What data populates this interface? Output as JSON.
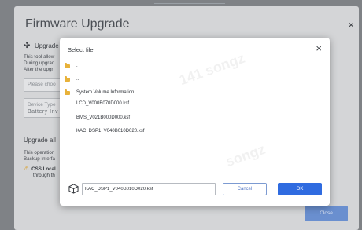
{
  "background": {
    "title": "Firmware Upgrade",
    "close_glyph": "×",
    "section_upgrade": "Upgrade",
    "desc_lines": [
      "This tool allow",
      "During upgrad",
      "After the upgr"
    ],
    "choose_placeholder": "Please choo",
    "device_type_label": "Device Type",
    "device_type_value": "Battery Inv",
    "section_upgrade_all": "Upgrade all",
    "op_lines": [
      "This operation",
      "Backup Interfa"
    ],
    "warning_bold": "CSS Local",
    "warning_rest": "through th",
    "close_button": "Close"
  },
  "dialog": {
    "title": "Select file",
    "close_glyph": "×",
    "entries": [
      {
        "type": "folder",
        "name": "."
      },
      {
        "type": "folder",
        "name": ".."
      },
      {
        "type": "folder",
        "name": "System Volume Information"
      },
      {
        "type": "file",
        "name": "LCD_V000B070D000.ksf"
      },
      {
        "type": "file",
        "name": "BMS_V021B000D000.ksf"
      },
      {
        "type": "file",
        "name": "KAC_DSP1_V040B010D020.ksf"
      }
    ],
    "selected_file": "KAC_DSP1_V040B010D020.ksf",
    "cancel_label": "Cancel",
    "ok_label": "OK"
  },
  "colors": {
    "accent": "#2f6be0",
    "folder": "#e8b23a"
  }
}
